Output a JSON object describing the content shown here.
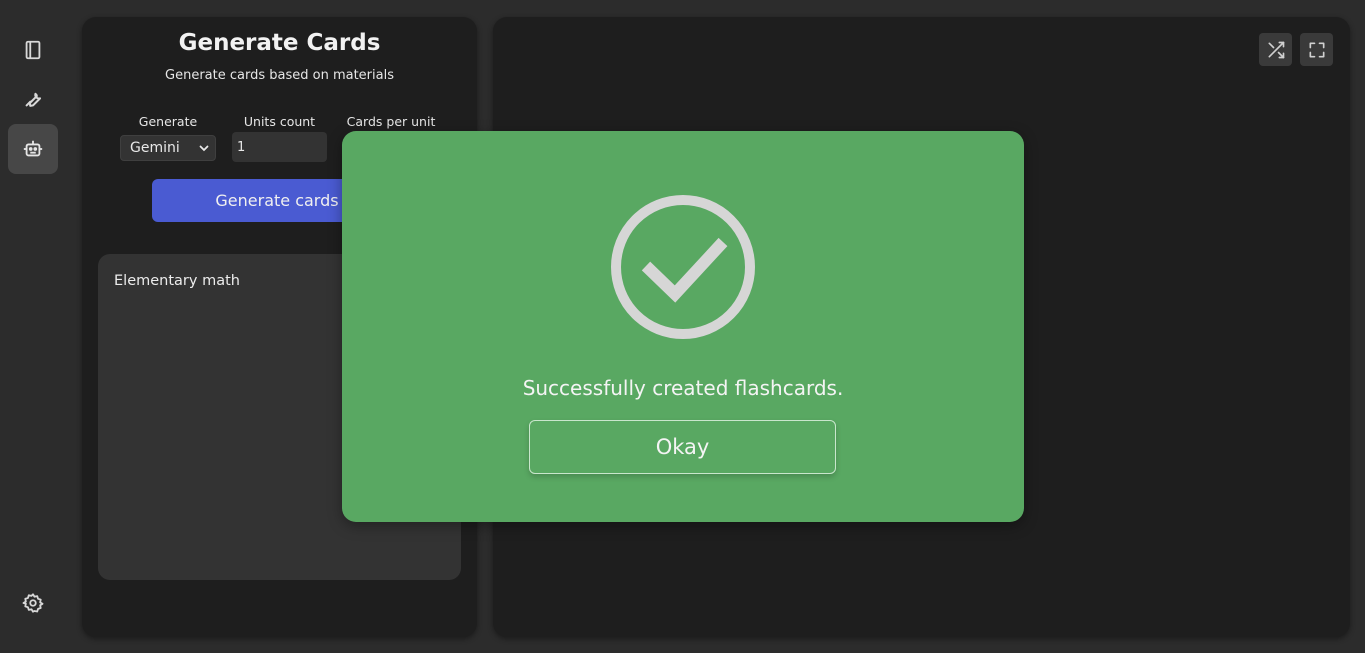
{
  "sidebar": {
    "items": [
      {
        "icon": "book-icon",
        "active": false
      },
      {
        "icon": "wrench-icon",
        "active": false
      },
      {
        "icon": "robot-icon",
        "active": true
      }
    ],
    "bottom_icon": "gear-icon"
  },
  "generator": {
    "title": "Generate Cards",
    "subtitle": "Generate cards based on materials",
    "generate_label": "Generate",
    "generate_value": "Gemini",
    "units_label": "Units count",
    "units_value": "1",
    "cards_per_unit_label": "Cards per unit",
    "button_label": "Generate cards",
    "material_text": "Elementary math"
  },
  "viewer": {
    "tools": [
      "shuffle-icon",
      "fullscreen-icon"
    ]
  },
  "modal": {
    "icon": "check-circle-icon",
    "message": "Successfully created flashcards.",
    "button_label": "Okay",
    "background": "#59a862"
  },
  "colors": {
    "accent": "#4a5bd2",
    "success": "#59a862",
    "panel": "#1e1e1e",
    "background": "#2c2c2c"
  }
}
